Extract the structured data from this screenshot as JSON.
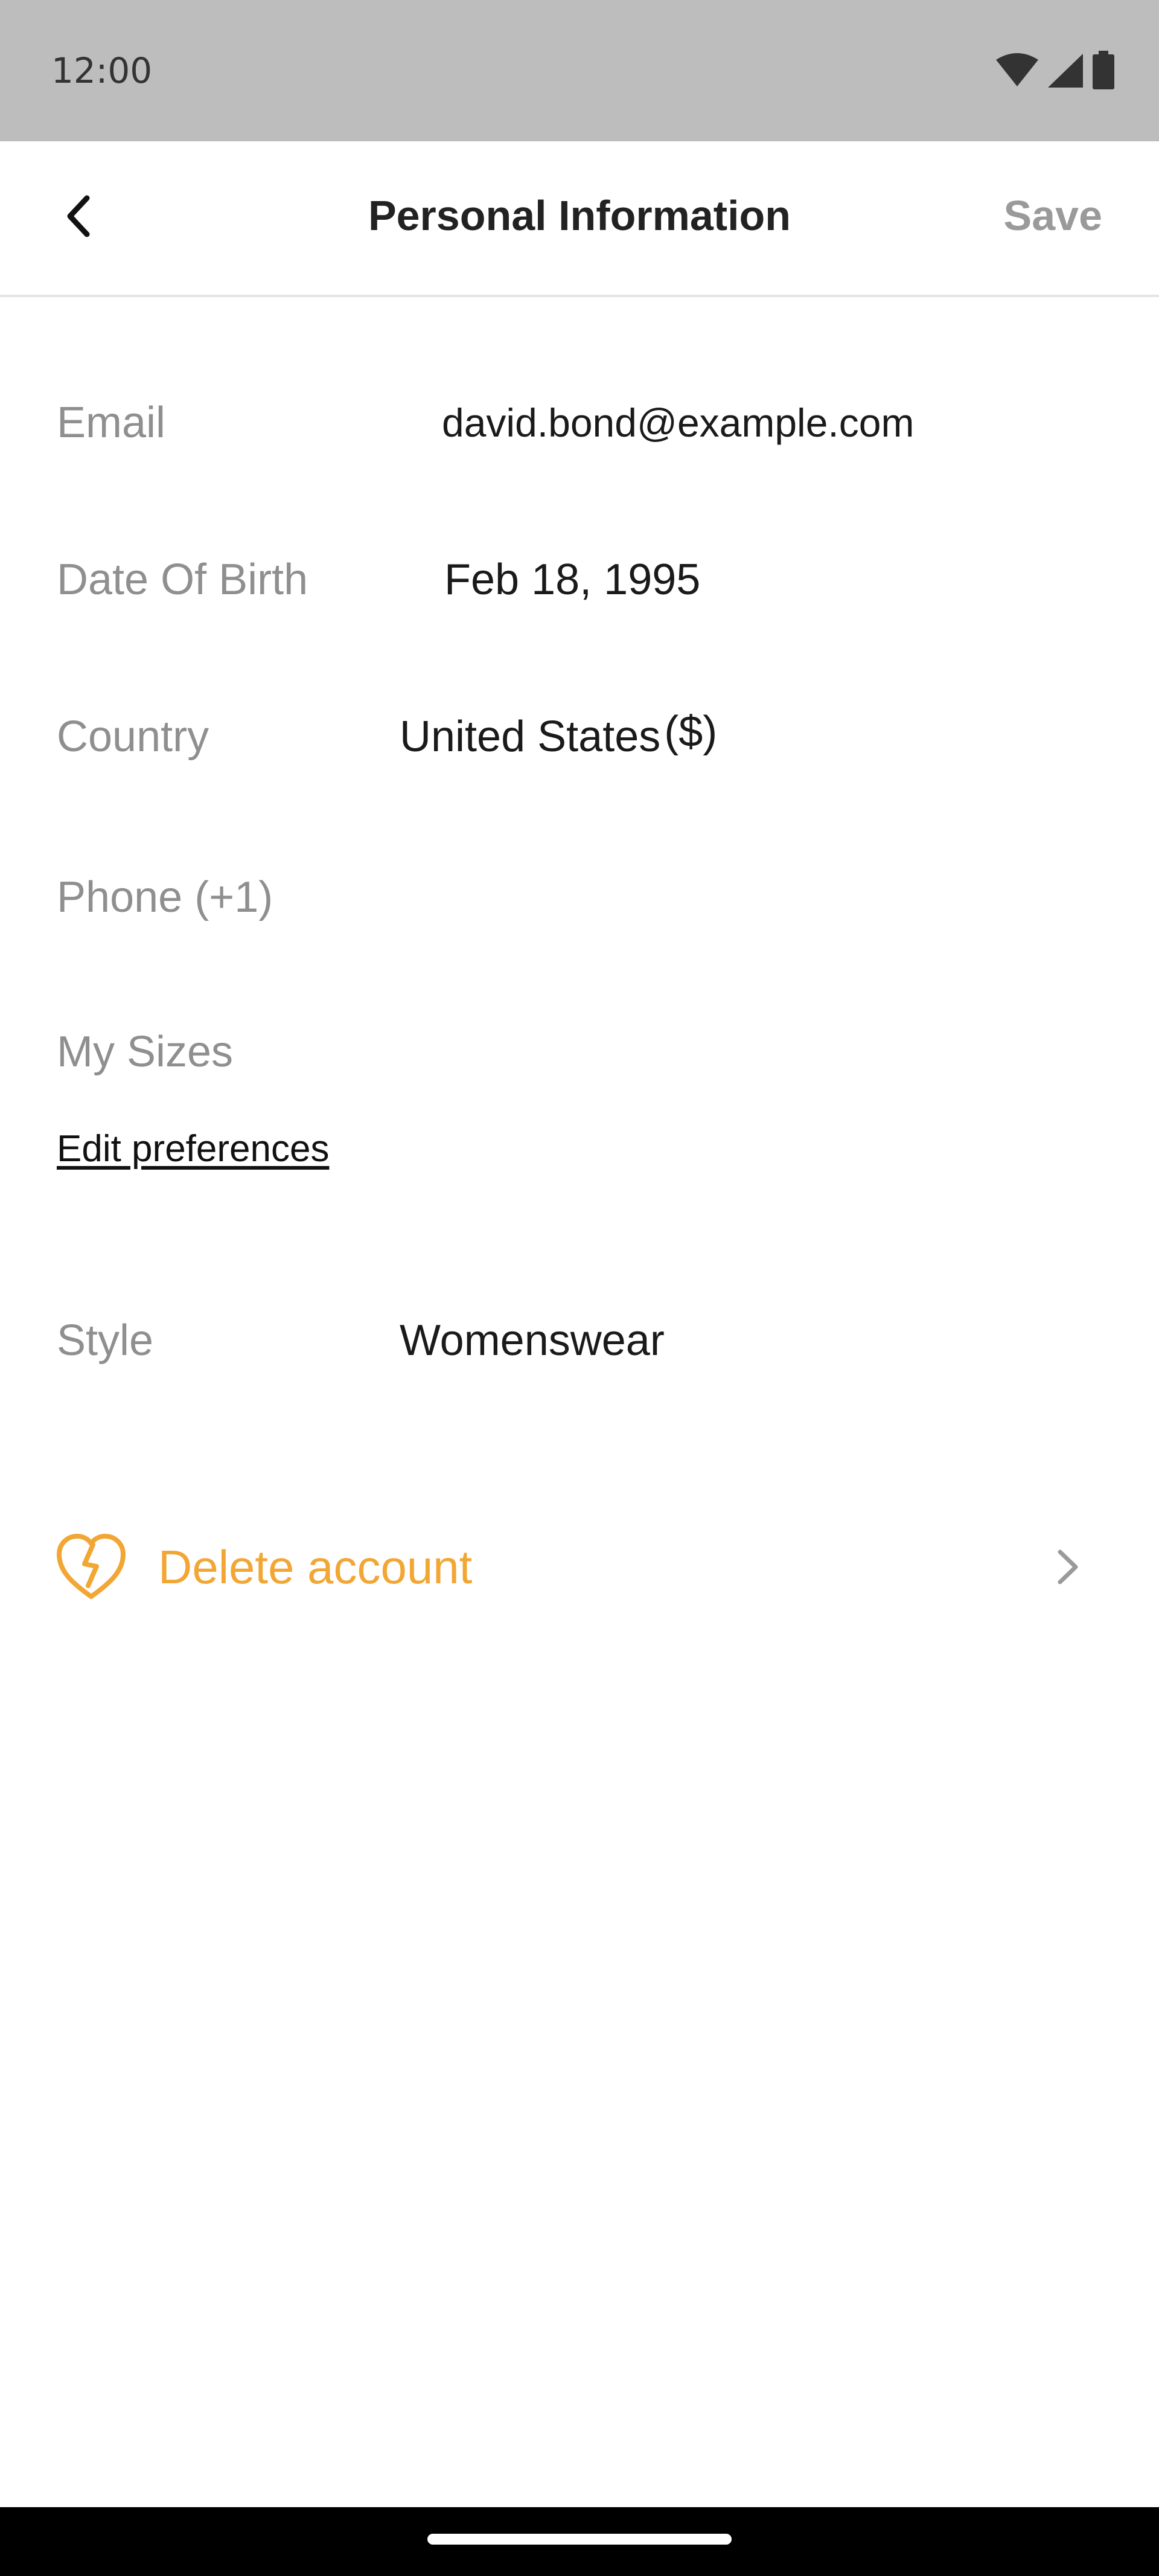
{
  "status_bar": {
    "time": "12:00",
    "icons": [
      "wifi-icon",
      "cellular-signal-icon",
      "battery-icon"
    ]
  },
  "app_bar": {
    "back_icon": "chevron-left-icon",
    "title": "Personal Information",
    "save_label": "Save"
  },
  "form": {
    "email": {
      "label": "Email",
      "value": "david.bond@example.com"
    },
    "date_of_birth": {
      "label": "Date Of Birth",
      "value": "Feb 18, 1995"
    },
    "country": {
      "label": "Country",
      "value": "United States",
      "currency": "($)"
    },
    "phone": {
      "label": "Phone (+1)",
      "value": ""
    },
    "sizes": {
      "label": "My Sizes",
      "edit_link": "Edit preferences"
    },
    "style": {
      "label": "Style",
      "value": "Womenswear"
    }
  },
  "delete_account": {
    "icon": "broken-heart-icon",
    "label": "Delete account",
    "chevron_icon": "chevron-right-icon"
  },
  "colors": {
    "status_bar_bg": "#bdbdbd",
    "label_gray": "#8f8f8f",
    "save_disabled": "#9a9a9a",
    "accent_orange": "#f2a634",
    "nav_bar_bg": "#000000"
  }
}
